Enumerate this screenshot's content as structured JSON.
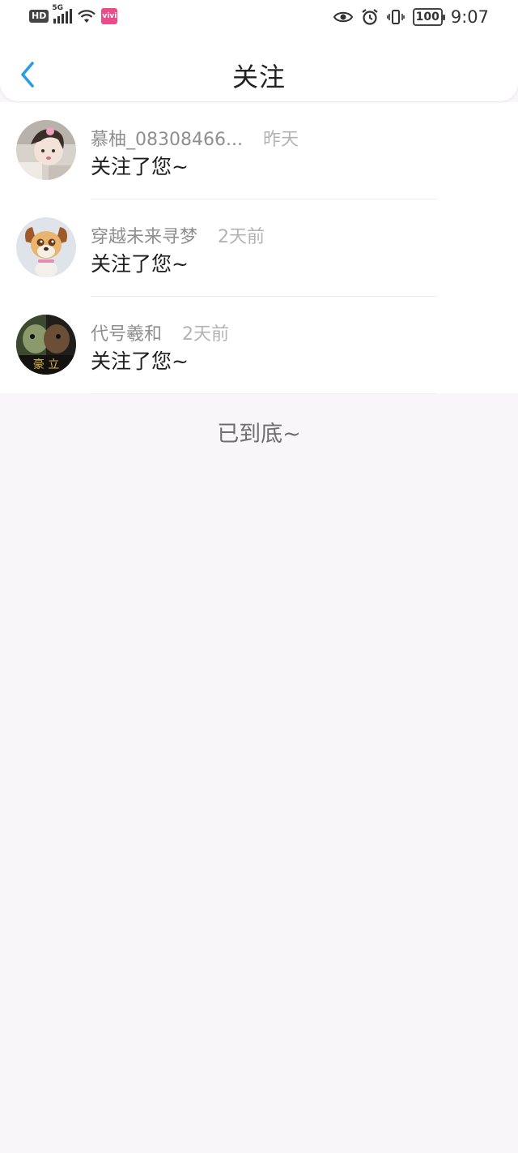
{
  "status_bar": {
    "network_badge": "HD",
    "network_gen": "5G",
    "app_badge": "vivi",
    "battery": "100",
    "time": "9:07",
    "icons": [
      "eye-icon",
      "alarm-icon",
      "vibrate-icon"
    ]
  },
  "header": {
    "title": "关注",
    "back_icon": "chevron-left-icon",
    "accent_color": "#2b9ce0"
  },
  "notifications": [
    {
      "name": "慕柚_08308466...",
      "time": "昨天",
      "message": "关注了您~"
    },
    {
      "name": "穿越未来寻梦",
      "time": "2天前",
      "message": "关注了您~"
    },
    {
      "name": "代号羲和",
      "time": "2天前",
      "message": "关注了您~"
    }
  ],
  "avatar3_text": "豪 立",
  "footer": {
    "end_text": "已到底~"
  }
}
